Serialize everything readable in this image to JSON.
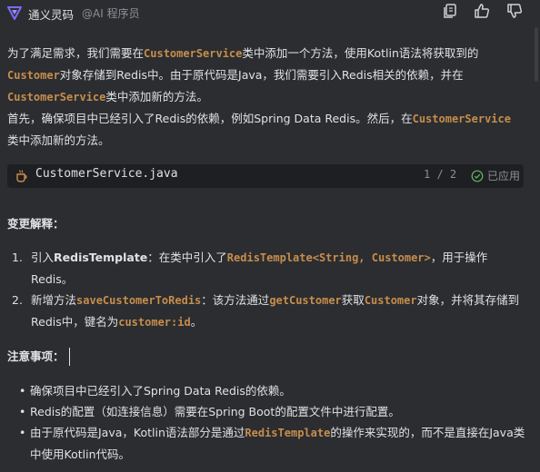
{
  "header": {
    "app_name": "通义灵码",
    "app_sub": "@AI 程序员",
    "tools": [
      "copy-icon",
      "thumbs-up-icon",
      "thumbs-down-icon"
    ]
  },
  "para1": {
    "t1": "为了满足需求，我们需要在",
    "c1": "CustomerService",
    "t2": "类中添加一个方法，使用Kotlin语法将获取到的",
    "c2": "Customer",
    "t3": "对象存储到Redis中。由于原代码是Java，我们需要引入Redis相关的依赖，并在",
    "c3": "CustomerService",
    "t4": "类中添加新的方法。"
  },
  "para2": {
    "t1": "首先，确保项目中已经引入了Redis的依赖，例如Spring Data Redis。然后，在",
    "c1": "CustomerService",
    "t2": "类中添加新的方法。"
  },
  "codebar": {
    "filename": "CustomerService.java",
    "page": "1 / 2",
    "status": "已应用"
  },
  "explain": {
    "heading": "变更解释：",
    "items": [
      {
        "num": "1.",
        "p1": "引入",
        "b1": "RedisTemplate",
        "p2": "：在类中引入了",
        "c1": "RedisTemplate<String, Customer>",
        "p3": "，用于操作Redis。"
      },
      {
        "num": "2.",
        "p1": "新增方法",
        "b1": "saveCustomerToRedis",
        "p2": "：该方法通过",
        "c1": "getCustomer",
        "p3": "获取",
        "c2": "Customer",
        "p4": "对象，并将其存储到Redis中，键名为",
        "c3": "customer:id",
        "p5": "。"
      }
    ]
  },
  "notes": {
    "heading": "注意事项：",
    "items": [
      {
        "t1": "确保项目中已经引入了Spring Data Redis的依赖。"
      },
      {
        "t1": "Redis的配置（如连接信息）需要在Spring Boot的配置文件中进行配置。"
      },
      {
        "t1": "由于原代码是Java，Kotlin语法部分是通过",
        "c1": "RedisTemplate",
        "t2": "的操作来实现的，而不是直接在Java类中使用Kotlin代码。"
      }
    ]
  },
  "colors": {
    "background": "#2b2d30",
    "code_highlight": "#c78d4d",
    "logo": "#7b6cf6",
    "muted": "#8c8f94"
  }
}
